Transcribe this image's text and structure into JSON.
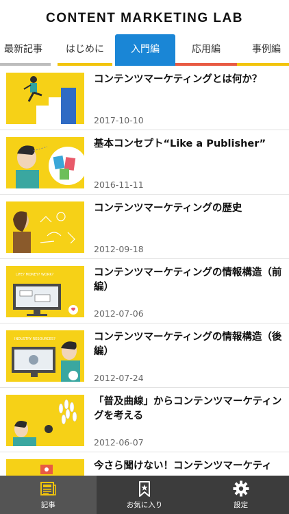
{
  "header": {
    "title": "CONTENT MARKETING LAB"
  },
  "tabs": [
    {
      "label": "最新記事",
      "color": "#bdbdbd"
    },
    {
      "label": "はじめに",
      "color": "#f2c40c"
    },
    {
      "label": "入門編",
      "color": "#1a86d6",
      "active": true
    },
    {
      "label": "応用編",
      "color": "#e85a43"
    },
    {
      "label": "事例編",
      "color": "#f2c40c"
    }
  ],
  "articles": [
    {
      "title": "コンテンツマーケティングとは何か？",
      "date": "2017-10-10",
      "thumb_icon": "stairs-runner-illustration"
    },
    {
      "title": "基本コンセプト“Like a Publisher”",
      "date": "2016-11-11",
      "thumb_icon": "publisher-man-illustration"
    },
    {
      "title": "コンテンツマーケティングの歴史",
      "date": "2012-09-18",
      "thumb_icon": "history-caveman-illustration"
    },
    {
      "title": "コンテンツマーケティングの情報構造（前編）",
      "date": "2012-07-06",
      "thumb_icon": "blog-monitor-illustration"
    },
    {
      "title": "コンテンツマーケティングの情報構造（後編）",
      "date": "2012-07-24",
      "thumb_icon": "monitor-tools-illustration"
    },
    {
      "title": "「普及曲線」からコンテンツマーケティングを考える",
      "date": "2012-06-07",
      "thumb_icon": "bowling-illustration"
    },
    {
      "title": "今さら聞けない！コンテンツマーケティ",
      "date": "",
      "thumb_icon": "question-illustration"
    }
  ],
  "bottom_nav": [
    {
      "label": "記事",
      "icon": "newspaper-icon",
      "active": true
    },
    {
      "label": "お気に入り",
      "icon": "bookmark-star-icon"
    },
    {
      "label": "設定",
      "icon": "gear-icon"
    }
  ],
  "colors": {
    "accent": "#1a86d6",
    "thumb_bg": "#f6d117",
    "nav_bg": "#3c3c3c",
    "nav_active": "#f2c40c"
  }
}
